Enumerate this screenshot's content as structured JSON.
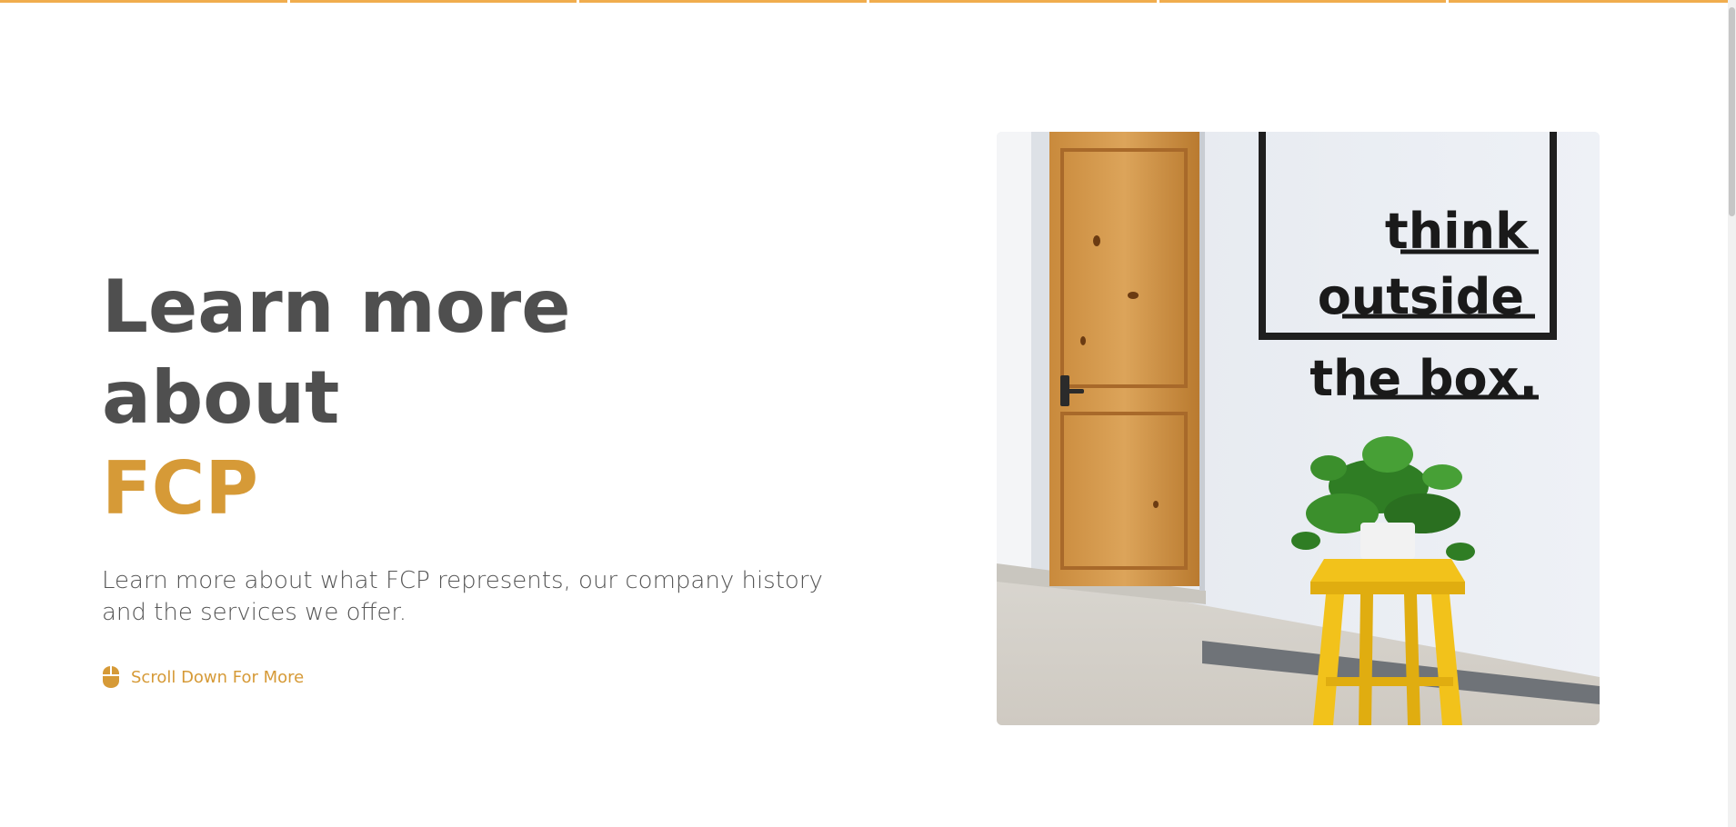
{
  "headline": {
    "line1": "Learn more about",
    "line2": "FCP"
  },
  "subtitle": "Learn more about what FCP represents, our company history and the services we offer.",
  "scroll_cta": {
    "label": "Scroll Down For More",
    "icon": "mouse-icon"
  },
  "photo": {
    "sign_lines": [
      "think",
      "outside",
      "the box."
    ]
  },
  "colors": {
    "accent": "#d69a37",
    "heading": "#4f4f4f",
    "body_text": "#555555",
    "top_bar": "#f0ad4e"
  }
}
